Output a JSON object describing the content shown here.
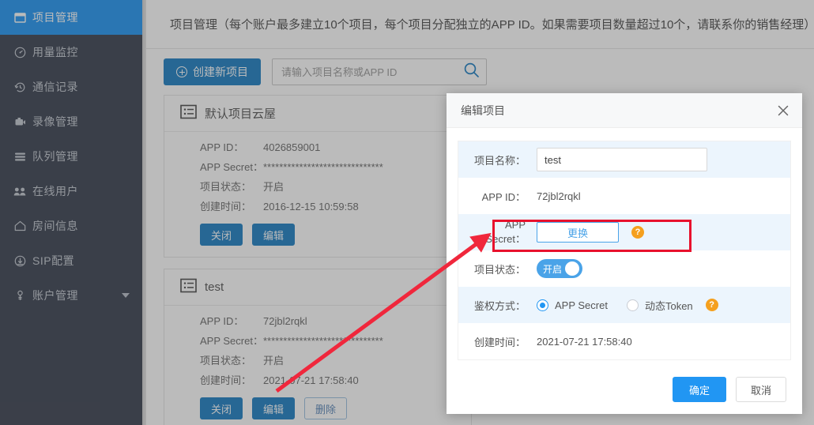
{
  "sidebar": {
    "items": [
      {
        "label": "项目管理",
        "icon": "folder-icon",
        "active": true,
        "caret": false
      },
      {
        "label": "用量监控",
        "icon": "gauge-icon",
        "active": false,
        "caret": false
      },
      {
        "label": "通信记录",
        "icon": "history-icon",
        "active": false,
        "caret": false
      },
      {
        "label": "录像管理",
        "icon": "camera-icon",
        "active": false,
        "caret": false
      },
      {
        "label": "队列管理",
        "icon": "queue-icon",
        "active": false,
        "caret": false
      },
      {
        "label": "在线用户",
        "icon": "users-icon",
        "active": false,
        "caret": false
      },
      {
        "label": "房间信息",
        "icon": "home-icon",
        "active": false,
        "caret": false
      },
      {
        "label": "SIP配置",
        "icon": "sip-icon",
        "active": false,
        "caret": false
      },
      {
        "label": "账户管理",
        "icon": "account-icon",
        "active": false,
        "caret": true
      }
    ]
  },
  "header": {
    "title": "项目管理（每个账户最多建立10个项目，每个项目分配独立的APP ID。如果需要项目数量超过10个，请联系你的销售经理）"
  },
  "toolbar": {
    "create_label": "创建新项目",
    "search_placeholder": "请输入项目名称或APP ID",
    "search_value": "",
    "search_icon": "search-icon"
  },
  "cards": [
    {
      "title": "默认项目云屋",
      "labels": {
        "app_id": "APP ID：",
        "app_secret": "APP Secret：",
        "status": "项目状态：",
        "created": "创建时间："
      },
      "app_id": "4026859001",
      "app_secret": "******************************",
      "status": "开启",
      "created": "2016-12-15 10:59:58",
      "actions": [
        {
          "label": "关闭",
          "style": "primary"
        },
        {
          "label": "编辑",
          "style": "primary"
        }
      ]
    },
    {
      "title": "test",
      "labels": {
        "app_id": "APP ID：",
        "app_secret": "APP Secret：",
        "status": "项目状态：",
        "created": "创建时间："
      },
      "app_id": "72jbl2rqkl",
      "app_secret": "******************************",
      "status": "开启",
      "created": "2021-07-21 17:58:40",
      "actions": [
        {
          "label": "关闭",
          "style": "primary"
        },
        {
          "label": "编辑",
          "style": "primary"
        },
        {
          "label": "删除",
          "style": "ghost"
        }
      ]
    }
  ],
  "dialog": {
    "title": "编辑项目",
    "close_icon": "close-icon",
    "fields": {
      "name_label": "项目名称：",
      "name_value": "test",
      "appid_label": "APP ID：",
      "appid_value": "72jbl2rqkl",
      "secret_label": "APP Secret：",
      "secret_button": "更换",
      "secret_help_icon": "question-icon",
      "status_label": "项目状态：",
      "status_toggle_text": "开启",
      "auth_label": "鉴权方式：",
      "auth_option_1": "APP Secret",
      "auth_option_2": "动态Token",
      "auth_help_icon": "question-icon",
      "created_label": "创建时间：",
      "created_value": "2021-07-21 17:58:40"
    },
    "footer": {
      "ok_label": "确定",
      "cancel_label": "取消"
    }
  },
  "annotations": {
    "highlight_color": "#e8112d",
    "arrow_from": "编辑",
    "arrow_to": "APP Secret"
  },
  "colors": {
    "sidebar_bg": "#3a4150",
    "sidebar_active": "#2196f3",
    "primary": "#1c7fc4",
    "accent": "#2196f3",
    "help": "#f5a01e",
    "annotation": "#e8112d"
  }
}
